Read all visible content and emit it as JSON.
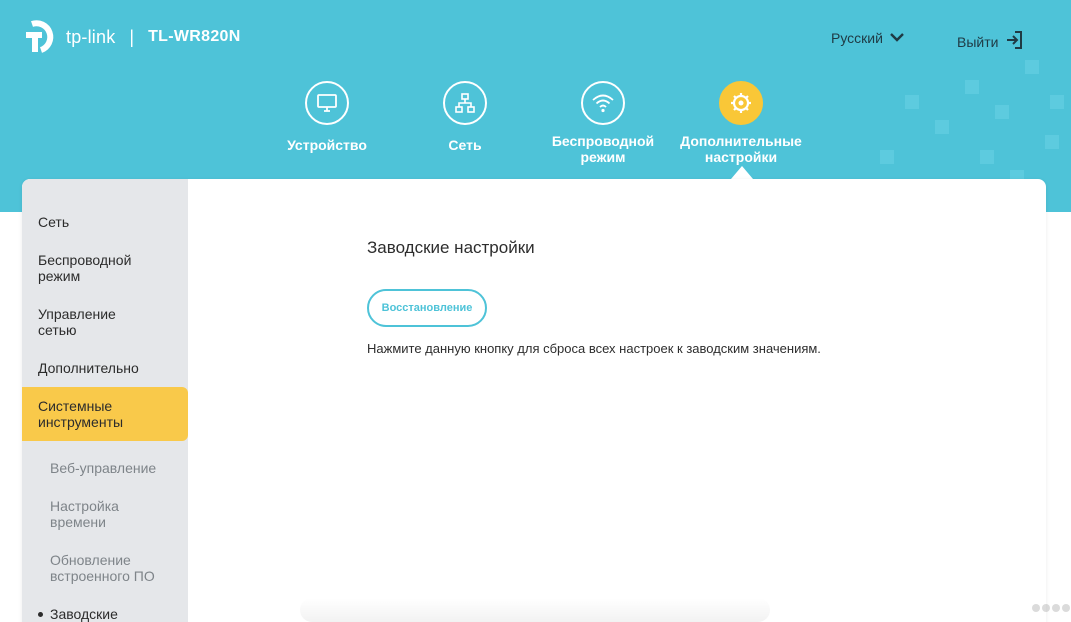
{
  "header": {
    "brand": "tp-link",
    "model": "TL-WR820N",
    "separator": "|",
    "language": "Русский",
    "logout": "Выйти",
    "accent_color": "#4ec3d8",
    "active_color": "#f9c737"
  },
  "nav": [
    {
      "label": "Устройство",
      "icon": "monitor-icon"
    },
    {
      "label": "Сеть",
      "icon": "network-icon"
    },
    {
      "label": "Беспроводной режим",
      "icon": "wifi-icon"
    },
    {
      "label": "Дополнительные настройки",
      "icon": "gear-icon",
      "active": true
    }
  ],
  "sidebar": {
    "items": [
      {
        "label": "Сеть"
      },
      {
        "label": "Беспроводной режим"
      },
      {
        "label": "Управление сетью"
      },
      {
        "label": "Дополнительно"
      },
      {
        "label": "Системные инструменты",
        "active": true
      }
    ],
    "subitems": [
      {
        "label": "Веб-управление"
      },
      {
        "label": "Настройка времени"
      },
      {
        "label": "Обновление встроенного ПО"
      },
      {
        "label": "Заводские",
        "current": true
      }
    ]
  },
  "main": {
    "title": "Заводские настройки",
    "button": "Восстановление",
    "description": "Нажмите данную кнопку для сброса всех настроек к заводским значениям."
  }
}
